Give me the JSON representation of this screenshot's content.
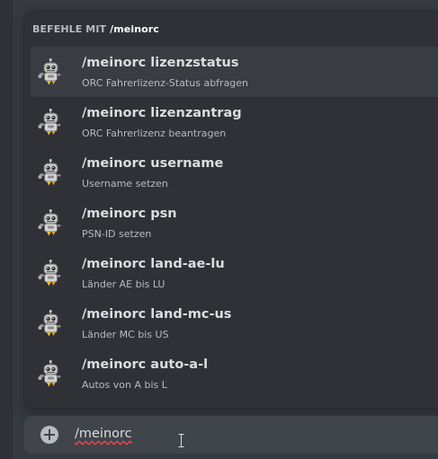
{
  "popup": {
    "header_prefix": "BEFEHLE MIT",
    "header_command": "/meinorc"
  },
  "commands": [
    {
      "name": "/meinorc lizenzstatus",
      "description": "ORC Fahrerlizenz-Status abfragen"
    },
    {
      "name": "/meinorc lizenzantrag",
      "description": "ORC Fahrerlizenz beantragen"
    },
    {
      "name": "/meinorc username",
      "description": "Username setzen"
    },
    {
      "name": "/meinorc psn",
      "description": "PSN-ID setzen"
    },
    {
      "name": "/meinorc land-ae-lu",
      "description": "Länder AE bis LU"
    },
    {
      "name": "/meinorc land-mc-us",
      "description": "Länder MC bis US"
    },
    {
      "name": "/meinorc auto-a-l",
      "description": "Autos von A bis L"
    }
  ],
  "chat_input": {
    "value": "/meinorc"
  },
  "icons": {
    "command_icon": "robot-bot-icon",
    "attach": "plus-circle-icon",
    "cursor": "text-cursor-icon"
  },
  "colors": {
    "background": "#36393f",
    "popup": "#2f3136",
    "active_row": "#393c43",
    "input": "#40444b",
    "spellcheck": "#f04747"
  }
}
